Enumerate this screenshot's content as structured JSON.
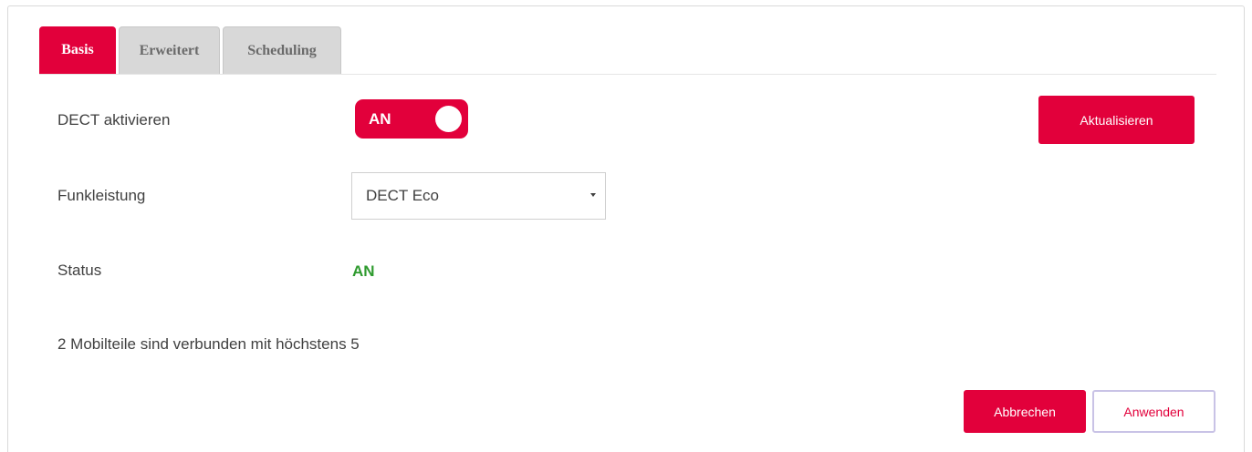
{
  "tabs": [
    {
      "label": "Basis",
      "active": true
    },
    {
      "label": "Erweitert",
      "active": false
    },
    {
      "label": "Scheduling",
      "active": false
    }
  ],
  "dect": {
    "label": "DECT aktivieren",
    "toggle_text": "AN",
    "toggle_on": true
  },
  "refresh_button": "Aktualisieren",
  "power": {
    "label": "Funkleistung",
    "selected": "DECT Eco"
  },
  "status": {
    "label": "Status",
    "value": "AN",
    "value_color": "#2e9a2e"
  },
  "handsets_text": "2  Mobilteile sind verbunden mit höchstens 5",
  "actions": {
    "cancel": "Abbrechen",
    "apply": "Anwenden"
  },
  "colors": {
    "accent": "#e2003b",
    "tab_inactive": "#d8d8d8"
  }
}
